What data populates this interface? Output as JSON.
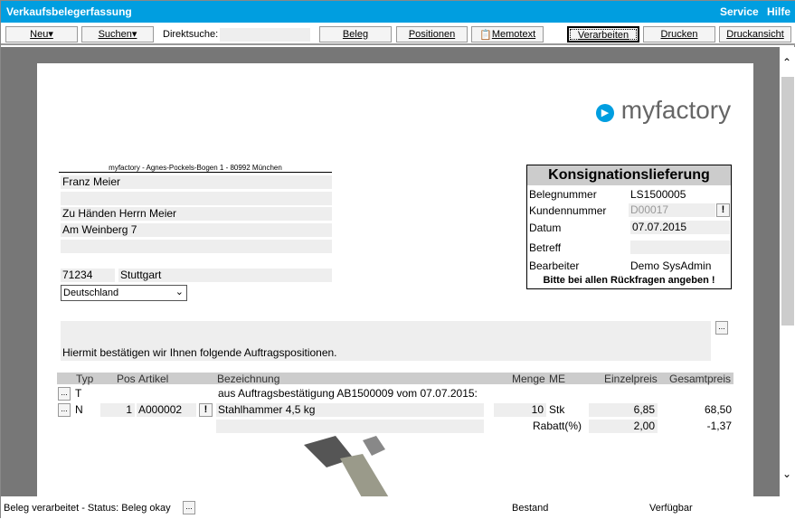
{
  "app": {
    "title": "Verkaufsbelegerfassung",
    "menu": [
      "Service",
      "Hilfe"
    ]
  },
  "toolbar": {
    "new": "Neu▾",
    "search": "Suchen▾",
    "direct_search_label": "Direktsuche:",
    "direct_search_value": "",
    "beleg": "Beleg",
    "positionen": "Positionen",
    "memotext": "Memotext",
    "verarbeiten": "Verarbeiten",
    "drucken": "Drucken",
    "druckansicht": "Druckansicht"
  },
  "logo": "myfactory",
  "address": {
    "sender": "myfactory - Agnes-Pockels-Bogen 1 - 80992 München",
    "line1": "Franz Meier",
    "line2": "",
    "line3": "Zu Händen Herrn Meier",
    "line4": "Am Weinberg 7",
    "line5": "",
    "zip": "71234",
    "city": "Stuttgart",
    "country": "Deutschland"
  },
  "docbox": {
    "title": "Konsignationslieferung",
    "rows": [
      {
        "label": "Belegnummer",
        "value": "LS1500005"
      },
      {
        "label": "Kundennummer",
        "value": "D00017"
      },
      {
        "label": "Datum",
        "value": "07.07.2015"
      },
      {
        "label": "Betreff",
        "value": ""
      },
      {
        "label": "Bearbeiter",
        "value": "Demo SysAdmin"
      }
    ],
    "footer": "Bitte bei allen Rückfragen angeben !"
  },
  "intro": "Hiermit bestätigen wir Ihnen folgende Auftragspositionen.",
  "table": {
    "headers": [
      "Typ",
      "Pos",
      "Artikel",
      "Bezeichnung",
      "Menge",
      "ME",
      "Einzelpreis",
      "Gesamtpreis"
    ],
    "rows": [
      {
        "typ": "T",
        "bez": "aus Auftragsbestätigung AB1500009 vom 07.07.2015:"
      },
      {
        "typ": "N",
        "pos": "1",
        "artikel": "A000002",
        "bez": "Stahlhammer 4,5 kg",
        "menge": "10",
        "me": "Stk",
        "einzel": "6,85",
        "gesamt": "68,50",
        "rabatt_label": "Rabatt(%)",
        "rabatt": "2,00",
        "rabatt_betrag": "-1,37"
      }
    ]
  },
  "status": {
    "text": "Beleg verarbeitet - Status: Beleg okay",
    "bestand": "Bestand",
    "verfuegbar": "Verfügbar"
  }
}
